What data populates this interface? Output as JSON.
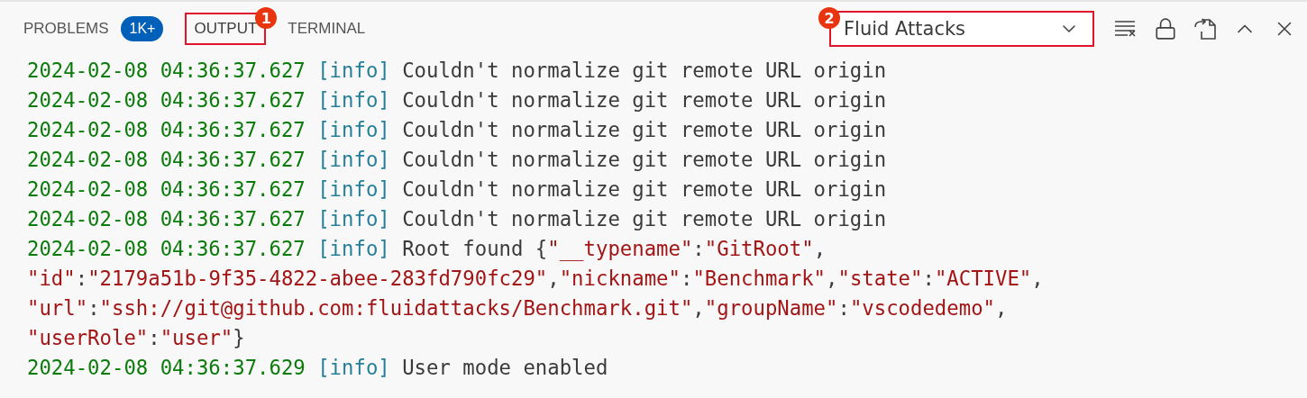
{
  "tabs": [
    {
      "label": "PROBLEMS",
      "selected": false,
      "badge": "1K+"
    },
    {
      "label": "OUTPUT",
      "selected": true,
      "callout": "1"
    },
    {
      "label": "TERMINAL",
      "selected": false
    }
  ],
  "channel_select": {
    "value": "Fluid Attacks",
    "callout": "2"
  },
  "log": [
    {
      "timestamp": "2024-02-08 04:36:37.627",
      "level": "[info]",
      "lines": [
        [
          {
            "kind": "plain",
            "text": "Couldn't normalize git remote URL origin"
          }
        ]
      ]
    },
    {
      "timestamp": "2024-02-08 04:36:37.627",
      "level": "[info]",
      "lines": [
        [
          {
            "kind": "plain",
            "text": "Couldn't normalize git remote URL origin"
          }
        ]
      ]
    },
    {
      "timestamp": "2024-02-08 04:36:37.627",
      "level": "[info]",
      "lines": [
        [
          {
            "kind": "plain",
            "text": "Couldn't normalize git remote URL origin"
          }
        ]
      ]
    },
    {
      "timestamp": "2024-02-08 04:36:37.627",
      "level": "[info]",
      "lines": [
        [
          {
            "kind": "plain",
            "text": "Couldn't normalize git remote URL origin"
          }
        ]
      ]
    },
    {
      "timestamp": "2024-02-08 04:36:37.627",
      "level": "[info]",
      "lines": [
        [
          {
            "kind": "plain",
            "text": "Couldn't normalize git remote URL origin"
          }
        ]
      ]
    },
    {
      "timestamp": "2024-02-08 04:36:37.627",
      "level": "[info]",
      "lines": [
        [
          {
            "kind": "plain",
            "text": "Couldn't normalize git remote URL origin"
          }
        ]
      ]
    },
    {
      "timestamp": "2024-02-08 04:36:37.627",
      "level": "[info]",
      "lines": [
        [
          {
            "kind": "plain",
            "text": "Root found {"
          },
          {
            "kind": "string",
            "text": "\"__typename\""
          },
          {
            "kind": "plain",
            "text": ":"
          },
          {
            "kind": "string",
            "text": "\"GitRoot\""
          },
          {
            "kind": "plain",
            "text": ","
          }
        ],
        [
          {
            "kind": "string",
            "text": "\"id\""
          },
          {
            "kind": "plain",
            "text": ":"
          },
          {
            "kind": "string",
            "text": "\"2179a51b-9f35-4822-abee-283fd790fc29\""
          },
          {
            "kind": "plain",
            "text": ","
          },
          {
            "kind": "string",
            "text": "\"nickname\""
          },
          {
            "kind": "plain",
            "text": ":"
          },
          {
            "kind": "string",
            "text": "\"Benchmark\""
          },
          {
            "kind": "plain",
            "text": ","
          },
          {
            "kind": "string",
            "text": "\"state\""
          },
          {
            "kind": "plain",
            "text": ":"
          },
          {
            "kind": "string",
            "text": "\"ACTIVE\""
          },
          {
            "kind": "plain",
            "text": ","
          }
        ],
        [
          {
            "kind": "string",
            "text": "\"url\""
          },
          {
            "kind": "plain",
            "text": ":"
          },
          {
            "kind": "string",
            "text": "\"ssh://git@github.com:fluidattacks/Benchmark.git\""
          },
          {
            "kind": "plain",
            "text": ","
          },
          {
            "kind": "string",
            "text": "\"groupName\""
          },
          {
            "kind": "plain",
            "text": ":"
          },
          {
            "kind": "string",
            "text": "\"vscodedemo\""
          },
          {
            "kind": "plain",
            "text": ","
          }
        ],
        [
          {
            "kind": "string",
            "text": "\"userRole\""
          },
          {
            "kind": "plain",
            "text": ":"
          },
          {
            "kind": "string",
            "text": "\"user\""
          },
          {
            "kind": "plain",
            "text": "}"
          }
        ]
      ]
    },
    {
      "timestamp": "2024-02-08 04:36:37.629",
      "level": "[info]",
      "lines": [
        [
          {
            "kind": "plain",
            "text": "User mode enabled"
          }
        ]
      ]
    }
  ]
}
